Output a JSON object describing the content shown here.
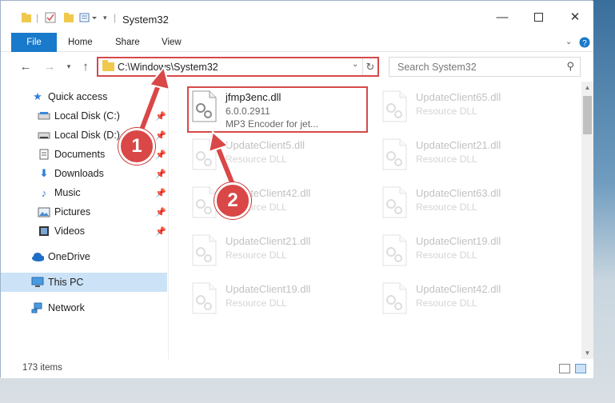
{
  "window": {
    "title": "System32"
  },
  "ribbon": {
    "tabs": [
      {
        "label": "File"
      },
      {
        "label": "Home"
      },
      {
        "label": "Share"
      },
      {
        "label": "View"
      }
    ]
  },
  "address": {
    "path": "C:\\Windows\\System32",
    "search_placeholder": "Search System32"
  },
  "sidebar": {
    "items": [
      {
        "label": "Quick access",
        "icon": "star-icon"
      },
      {
        "label": "Local Disk (C:)",
        "icon": "drive-icon"
      },
      {
        "label": "Local Disk (D:)",
        "icon": "drive-icon"
      },
      {
        "label": "Documents",
        "icon": "documents-icon"
      },
      {
        "label": "Downloads",
        "icon": "downloads-icon"
      },
      {
        "label": "Music",
        "icon": "music-icon"
      },
      {
        "label": "Pictures",
        "icon": "pictures-icon"
      },
      {
        "label": "Videos",
        "icon": "videos-icon"
      },
      {
        "label": "OneDrive",
        "icon": "cloud-icon"
      },
      {
        "label": "This PC",
        "icon": "computer-icon"
      },
      {
        "label": "Network",
        "icon": "network-icon"
      }
    ]
  },
  "files": [
    {
      "name": "jfmp3enc.dll",
      "version": "6.0.0.2911",
      "description": "MP3 Encoder for jet..."
    },
    {
      "name": "UpdateClient65.dll",
      "description": "Resource DLL"
    },
    {
      "name": "UpdateClient5.dll",
      "description": "Resource DLL"
    },
    {
      "name": "UpdateClient21.dll",
      "description": "Resource DLL"
    },
    {
      "name": "UpdateClient42.dll",
      "description": "Resource DLL"
    },
    {
      "name": "UpdateClient63.dll",
      "description": "Resource DLL"
    },
    {
      "name": "UpdateClient21.dll",
      "description": "Resource DLL"
    },
    {
      "name": "UpdateClient19.dll",
      "description": "Resource DLL"
    },
    {
      "name": "UpdateClient19.dll",
      "description": "Resource DLL"
    },
    {
      "name": "UpdateClient42.dll",
      "description": "Resource DLL"
    }
  ],
  "status": {
    "item_count": "173 items"
  },
  "callouts": {
    "one": "1",
    "two": "2"
  },
  "colors": {
    "accent": "#1979ca",
    "highlight": "#d64a4a",
    "selected": "#cce3f7"
  }
}
